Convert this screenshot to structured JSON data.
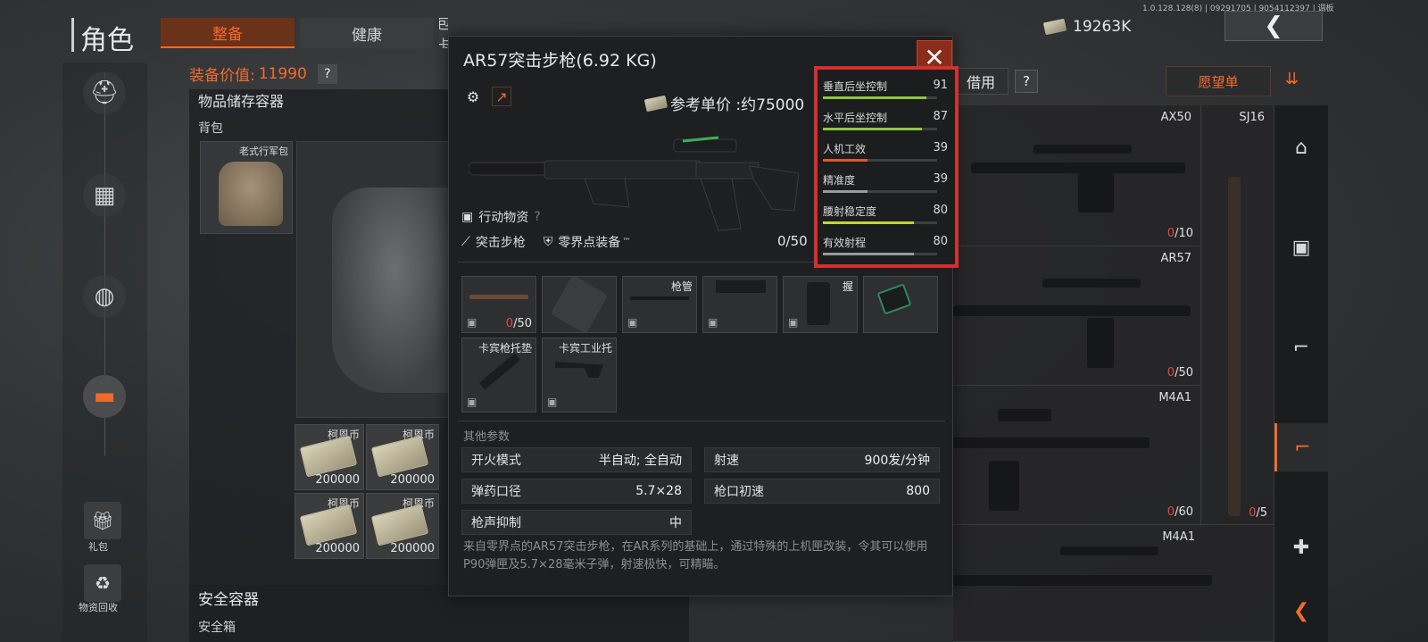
{
  "version_text": "1.0.128.128(8) | 09291705 | 9054112397 | 调板",
  "header": {
    "page_title": "角色",
    "tabs": [
      {
        "label": "整备",
        "active": true
      },
      {
        "label": "健康",
        "active": false
      },
      {
        "label": "礼包卡券",
        "active": false
      }
    ],
    "currency_value": "19263K",
    "back_icon": "chevron-left-icon"
  },
  "left": {
    "equip_value_label": "装备价值: ",
    "equip_value": "11990",
    "help": "?",
    "storage_title": "物品储存容器",
    "backpack_label": "背包",
    "backpack_name": "老式行军包",
    "money_slots": [
      {
        "label": "柯恩币",
        "value": "200000"
      },
      {
        "label": "柯恩币",
        "value": "200000"
      },
      {
        "label": "柯恩币",
        "value": "200000"
      },
      {
        "label": "柯恩币",
        "value": "200000"
      }
    ],
    "gift_label": "礼包",
    "recycle_label": "物资回收",
    "safe_title": "安全容器",
    "safe_sub": "安全箱"
  },
  "modal": {
    "title": "AR57突击步枪(6.92 KG)",
    "price_label": "参考单价 :约75000",
    "category1": "行动物资",
    "help": "?",
    "category2": "突击步枪",
    "category3": "零界点装备",
    "tm": "™",
    "ammo_count": "0/50",
    "stats": [
      {
        "name": "垂直后坐控制",
        "value": 91,
        "color": "#8dc63f"
      },
      {
        "name": "水平后坐控制",
        "value": 87,
        "color": "#8dc63f"
      },
      {
        "name": "人机工效",
        "value": 39,
        "color": "#e0562a"
      },
      {
        "name": "精准度",
        "value": 39,
        "color": "#9a9a9a"
      },
      {
        "name": "腰射稳定度",
        "value": 80,
        "color": "#c6d23a"
      },
      {
        "name": "有效射程",
        "value": 80,
        "color": "#9a9a9a"
      }
    ],
    "attachments": [
      {
        "cap": "",
        "count_red": "0",
        "count_rest": "/50"
      },
      {
        "cap": "",
        "count_red": "",
        "count_rest": ""
      },
      {
        "cap": "枪管",
        "count_red": "",
        "count_rest": ""
      },
      {
        "cap": "",
        "count_red": "",
        "count_rest": ""
      },
      {
        "cap": "握",
        "count_red": "",
        "count_rest": ""
      },
      {
        "cap": "",
        "count_red": "",
        "count_rest": ""
      },
      {
        "cap": "卡宾枪托垫",
        "count_red": "",
        "count_rest": ""
      },
      {
        "cap": "卡宾工业托",
        "count_red": "",
        "count_rest": ""
      }
    ],
    "other_params_title": "其他参数",
    "params": [
      {
        "name": "开火模式",
        "value": "半自动; 全自动"
      },
      {
        "name": "射速",
        "value": "900发/分钟"
      },
      {
        "name": "弹药口径",
        "value": "5.7×28"
      },
      {
        "name": "枪口初速",
        "value": "800"
      },
      {
        "name": "枪声抑制",
        "value": "中"
      }
    ],
    "description": "来自零界点的AR57突击步枪，在AR系列的基础上，通过特殊的上机匣改装，令其可以使用P90弹匣及5.7×28毫米子弹，射速极快，可精瞄。"
  },
  "right": {
    "borrow_label": "借用",
    "help": "?",
    "wishlist_label": "愿望单",
    "guns": [
      {
        "name": "AX50",
        "count_red": "0",
        "count_rest": "/10"
      },
      {
        "name": "SJ16",
        "count_red": "",
        "count_rest": ""
      },
      {
        "name": "AR57",
        "count_red": "0",
        "count_rest": "/50"
      },
      {
        "name": "M4A1",
        "count_red": "0",
        "count_rest": "/60"
      },
      {
        "name": "",
        "count_red": "0",
        "count_rest": "/5"
      },
      {
        "name": "M4A1",
        "count_red": "",
        "count_rest": ""
      }
    ]
  }
}
